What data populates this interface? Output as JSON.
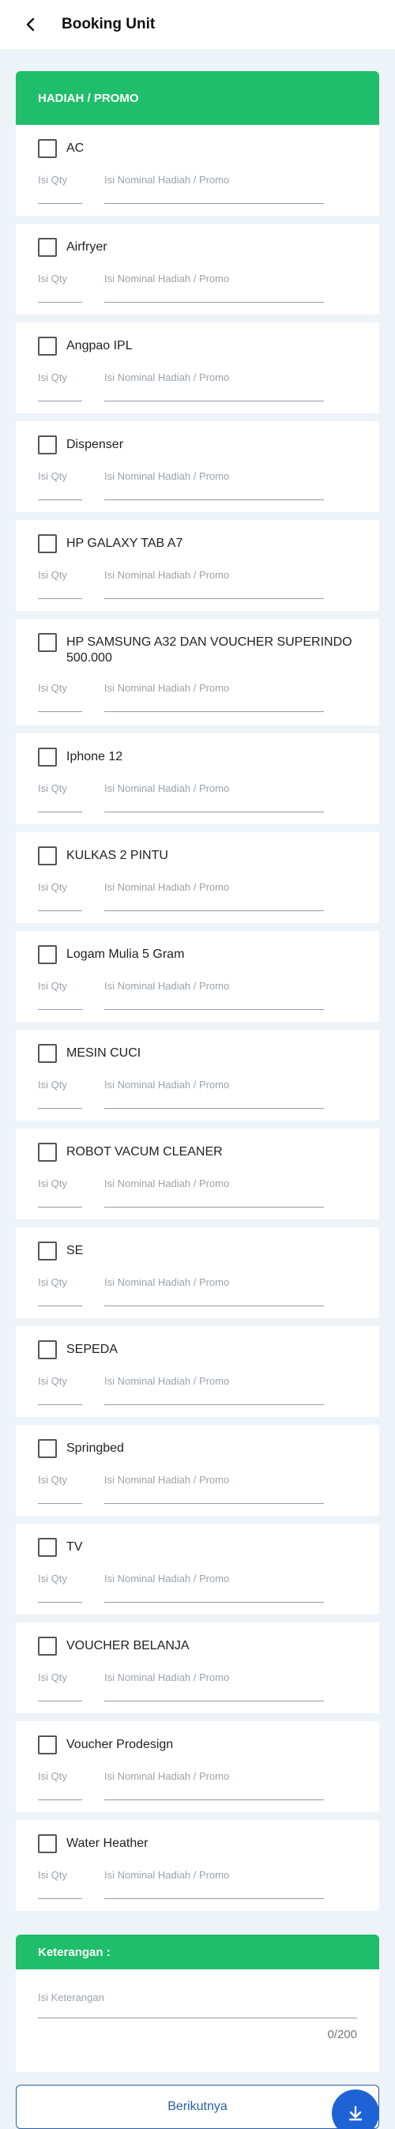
{
  "header": {
    "title": "Booking Unit",
    "back_icon": "arrow-left-icon"
  },
  "section": {
    "title": "HADIAH / PROMO"
  },
  "field_placeholders": {
    "qty": "Isi Qty",
    "nominal": "Isi Nominal Hadiah / Promo"
  },
  "items": [
    {
      "label": "AC"
    },
    {
      "label": "Airfryer"
    },
    {
      "label": "Angpao IPL"
    },
    {
      "label": "Dispenser"
    },
    {
      "label": "HP GALAXY TAB A7"
    },
    {
      "label": "HP SAMSUNG A32 DAN VOUCHER SUPERINDO 500.000"
    },
    {
      "label": "Iphone 12"
    },
    {
      "label": "KULKAS 2 PINTU"
    },
    {
      "label": "Logam Mulia 5 Gram"
    },
    {
      "label": "MESIN CUCI"
    },
    {
      "label": "ROBOT VACUM CLEANER"
    },
    {
      "label": "SE"
    },
    {
      "label": "SEPEDA"
    },
    {
      "label": "Springbed"
    },
    {
      "label": "TV"
    },
    {
      "label": "VOUCHER BELANJA"
    },
    {
      "label": "Voucher Prodesign"
    },
    {
      "label": "Water Heather"
    }
  ],
  "notes": {
    "title": "Keterangan :",
    "placeholder": "Isi Keterangan",
    "counter": "0/200"
  },
  "next_button": {
    "label": "Berikutnya"
  },
  "fab": {
    "icon": "download-icon"
  },
  "colors": {
    "accent_green": "#1fbe6a",
    "primary_blue": "#2a5fa5",
    "fab_blue": "#1e63d6"
  }
}
